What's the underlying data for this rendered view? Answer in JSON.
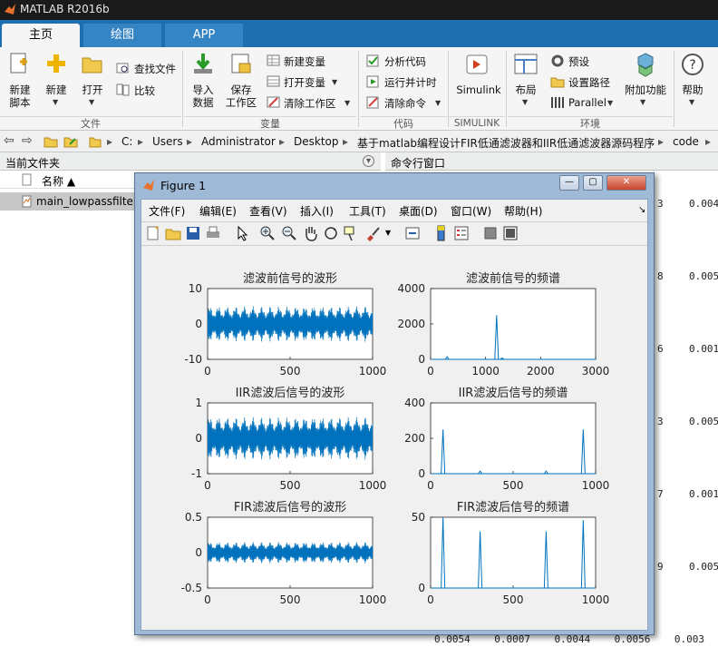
{
  "window": {
    "title": "MATLAB R2016b"
  },
  "tabs": [
    {
      "label": "主页"
    },
    {
      "label": "绘图"
    },
    {
      "label": "APP"
    }
  ],
  "ribbon": {
    "file": {
      "new_script": "新建\n脚本",
      "new": "新建",
      "open": "打开",
      "find_files": "查找文件",
      "compare": "比较",
      "group": "文件"
    },
    "variable": {
      "import": "导入\n数据",
      "save_ws": "保存\n工作区",
      "new_var": "新建变量",
      "open_var": "打开变量",
      "clear_ws": "清除工作区",
      "group": "变量"
    },
    "code": {
      "analyze": "分析代码",
      "run_time": "运行并计时",
      "clear_cmds": "清除命令",
      "group": "代码"
    },
    "simulink": {
      "simulink": "Simulink",
      "group": "SIMULINK"
    },
    "env": {
      "layout": "布局",
      "prefs": "预设",
      "set_path": "设置路径",
      "parallel": "Parallel",
      "addons": "附加功能",
      "group": "环境"
    },
    "help": {
      "help": "帮助"
    }
  },
  "address": {
    "crumbs": [
      "C:",
      "Users",
      "Administrator",
      "Desktop",
      "基于matlab编程设计FIR低通滤波器和IIR低通滤波器源码程序",
      "code"
    ]
  },
  "panes": {
    "current_folder": "当前文件夹",
    "command_window": "命令行窗口",
    "col_name": "名称 ▲",
    "file": "main_lowpassfilter"
  },
  "cmd_numbers": [
    {
      "a": "3",
      "b": "0.004"
    },
    {
      "a": "8",
      "b": "0.005"
    },
    {
      "a": "6",
      "b": "0.001"
    },
    {
      "a": "3",
      "b": "0.005"
    },
    {
      "a": "7",
      "b": "0.001"
    },
    {
      "a": "9",
      "b": "0.005"
    }
  ],
  "cmd_bottom": "0.0054    0.0007    0.0044    0.0056    0.003",
  "figure": {
    "title": "Figure 1",
    "menu": [
      "文件(F)",
      "编辑(E)",
      "查看(V)",
      "插入(I)",
      "工具(T)",
      "桌面(D)",
      "窗口(W)",
      "帮助(H)"
    ]
  },
  "chart_data": [
    {
      "type": "line",
      "title": "滤波前信号的波形",
      "xlim": [
        0,
        1000
      ],
      "ylim": [
        -10,
        10
      ],
      "xticks": [
        "0",
        "500",
        "1000"
      ],
      "yticks": [
        "10",
        "0",
        "-10"
      ],
      "description_level": {
        "band_amplitude": 5
      }
    },
    {
      "type": "line",
      "title": "滤波前信号的频谱",
      "xlim": [
        0,
        3000
      ],
      "ylim": [
        0,
        4000
      ],
      "xticks": [
        "0",
        "1000",
        "2000",
        "3000"
      ],
      "yticks": [
        "4000",
        "2000",
        "0"
      ],
      "peaks": [
        {
          "x": 300,
          "y": 150
        },
        {
          "x": 1200,
          "y": 2500
        },
        {
          "x": 1300,
          "y": 80
        }
      ]
    },
    {
      "type": "line",
      "title": "IIR滤波后信号的波形",
      "xlim": [
        0,
        1000
      ],
      "ylim": [
        -1,
        1
      ],
      "xticks": [
        "0",
        "500",
        "1000"
      ],
      "yticks": [
        "1",
        "0",
        "-1"
      ],
      "description_level": {
        "band_amplitude": 0.6
      }
    },
    {
      "type": "line",
      "title": "IIR滤波后信号的频谱",
      "xlim": [
        0,
        1000
      ],
      "ylim": [
        0,
        400
      ],
      "xticks": [
        "0",
        "500",
        "1000"
      ],
      "yticks": [
        "400",
        "200",
        "0"
      ],
      "peaks": [
        {
          "x": 75,
          "y": 250
        },
        {
          "x": 300,
          "y": 15
        },
        {
          "x": 700,
          "y": 15
        },
        {
          "x": 925,
          "y": 250
        }
      ]
    },
    {
      "type": "line",
      "title": "FIR滤波后信号的波形",
      "xlim": [
        0,
        1000
      ],
      "ylim": [
        -0.5,
        0.5
      ],
      "xticks": [
        "0",
        "500",
        "1000"
      ],
      "yticks": [
        "0.5",
        "0",
        "-0.5"
      ],
      "description_level": {
        "band_amplitude": 0.15
      }
    },
    {
      "type": "line",
      "title": "FIR滤波后信号的频谱",
      "xlim": [
        0,
        1000
      ],
      "ylim": [
        0,
        50
      ],
      "xticks": [
        "0",
        "500",
        "1000"
      ],
      "yticks": [
        "50",
        "0"
      ],
      "peaks": [
        {
          "x": 75,
          "y": 50
        },
        {
          "x": 300,
          "y": 40
        },
        {
          "x": 700,
          "y": 40
        },
        {
          "x": 925,
          "y": 48
        }
      ]
    }
  ],
  "colors": {
    "line": "#0072bd",
    "tab_bar": "#1f6fb0"
  }
}
